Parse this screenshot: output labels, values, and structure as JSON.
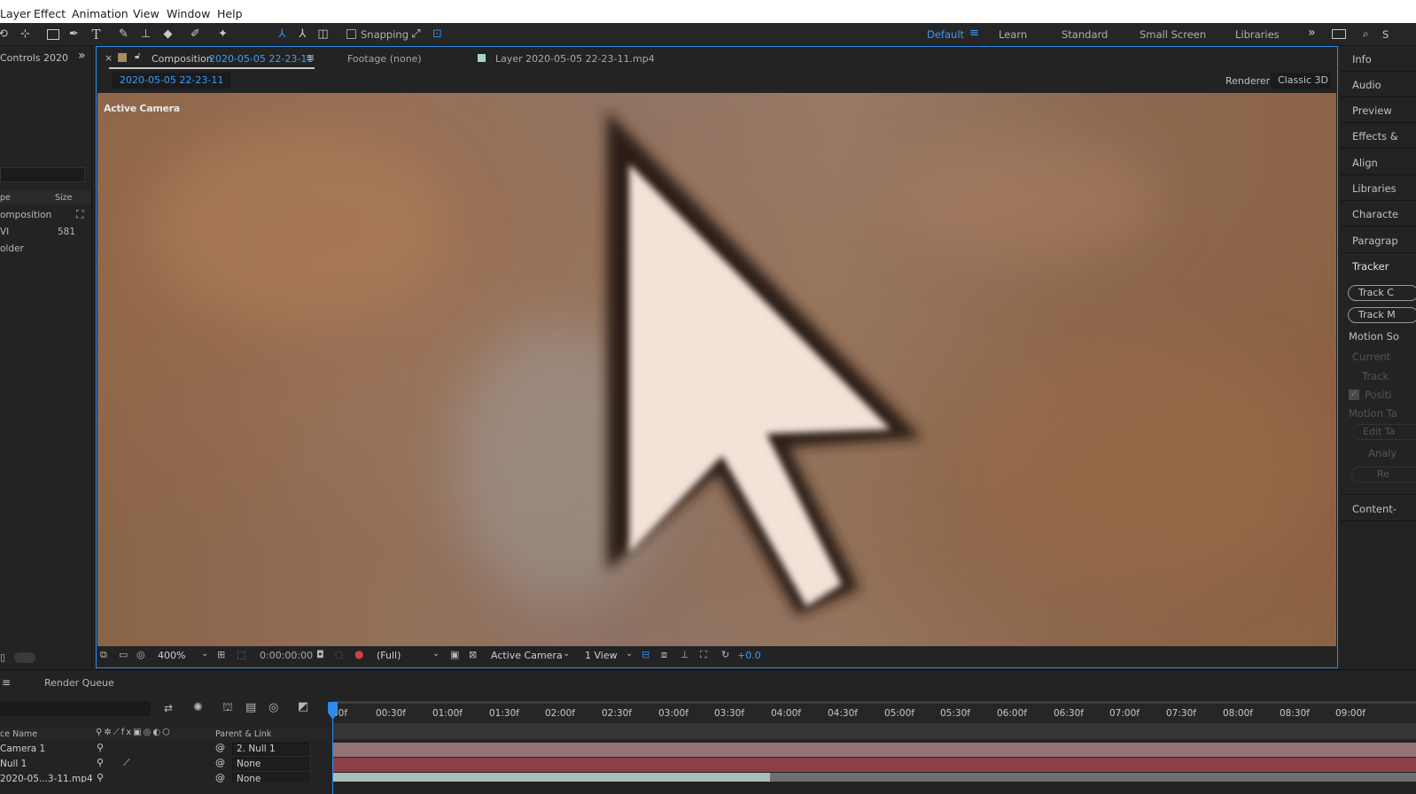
{
  "menu": [
    "Layer",
    "Effect",
    "Animation",
    "View",
    "Window",
    "Help"
  ],
  "toolbar": {
    "snapping_label": "Snapping",
    "workspaces": [
      "Default",
      "Learn",
      "Standard",
      "Small Screen",
      "Libraries"
    ],
    "search_partial": "S"
  },
  "left_panel": {
    "tab_label": "Controls 2020",
    "columns": [
      "pe",
      "Size"
    ],
    "items": [
      {
        "type": "omposition",
        "size": ""
      },
      {
        "type": "VI",
        "size": "581"
      },
      {
        "type": "older",
        "size": ""
      }
    ]
  },
  "viewer": {
    "tabs": [
      {
        "prefix": "Composition",
        "name": "2020-05-05 22-23-11"
      },
      {
        "label": "Footage (none)"
      },
      {
        "label": "Layer 2020-05-05 22-23-11.mp4"
      }
    ],
    "breadcrumb": "2020-05-05 22-23-11",
    "renderer_label": "Renderer:",
    "renderer_value": "Classic 3D",
    "overlay_label": "Active Camera",
    "footer": {
      "zoom": "400%",
      "timecode": "0:00:00:00",
      "resolution": "(Full)",
      "camera": "Active Camera",
      "views": "1 View",
      "exposure": "+0.0"
    }
  },
  "right_panel": {
    "items": [
      "Info",
      "Audio",
      "Preview",
      "Effects &",
      "Align",
      "Libraries",
      "Characte",
      "Paragrap",
      "Tracker"
    ],
    "tracker": {
      "buttons": [
        "Track C",
        "Track M"
      ],
      "motion_source": "Motion So",
      "current": "Current",
      "track": "Track",
      "position": "Positi",
      "motion_target": "Motion Ta",
      "edit": "Edit Ta",
      "analyze": "Analy",
      "reset": "Re"
    },
    "content": "Content-"
  },
  "timeline": {
    "render_queue_label": "Render Queue",
    "ruler": [
      "00f",
      "00:30f",
      "01:00f",
      "01:30f",
      "02:00f",
      "02:30f",
      "03:00f",
      "03:30f",
      "04:00f",
      "04:30f",
      "05:00f",
      "05:30f",
      "06:00f",
      "06:30f",
      "07:00f",
      "07:30f",
      "08:00f",
      "08:30f",
      "09:00f"
    ],
    "columns": {
      "source_name": "ce Name",
      "parent": "Parent & Link"
    },
    "layers": [
      {
        "name": "Camera 1",
        "parent": "2. Null 1"
      },
      {
        "name": "Null 1",
        "parent": "None"
      },
      {
        "name": "2020-05...3-11.mp4",
        "parent": "None"
      }
    ]
  },
  "colors": {
    "accent": "#2d8ceb",
    "camera_bar": "#957278",
    "null_bar": "#8c4045",
    "footage_bar": "#a9bfb8"
  }
}
